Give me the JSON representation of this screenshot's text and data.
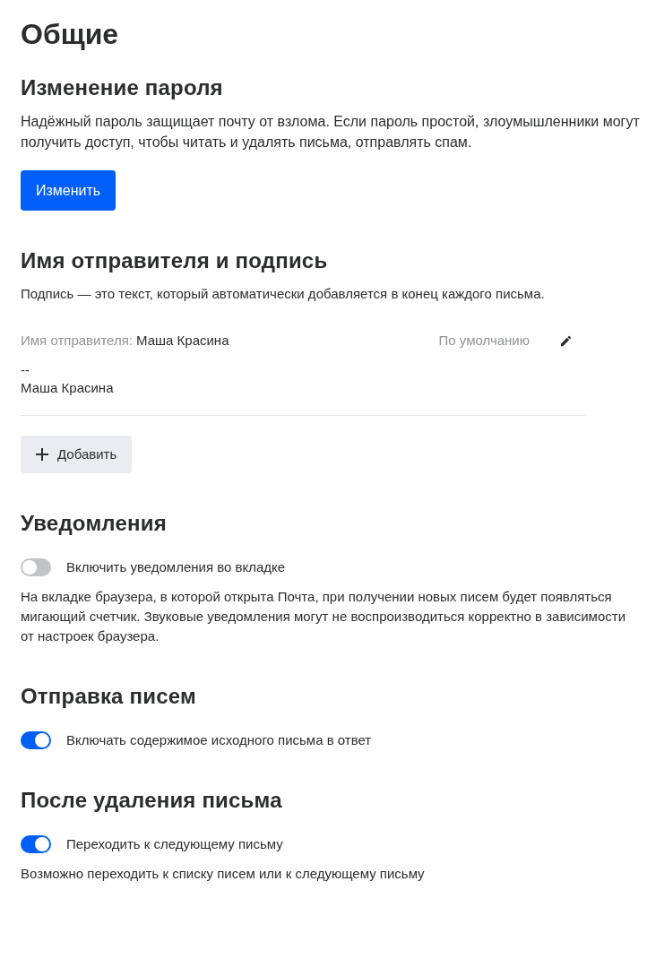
{
  "page_title": "Общие",
  "sections": [
    {
      "heading": "Изменение пароля",
      "items": [
        {
          "kind": "text",
          "text": "Надёжный пароль защищает почту от взлома. Если пароль простой, злоумышленники могут получить доступ, чтобы читать и удалять письма, отправлять спам."
        },
        {
          "kind": "button",
          "label": "Изменить"
        }
      ]
    },
    {
      "heading": "Имя отправителя и подпись",
      "items": [
        {
          "kind": "note",
          "text": "Подпись — это текст, который автоматически добавляется в конец каждого письма."
        },
        {
          "kind": "signature",
          "sender_label": "Имя отправителя:",
          "sender_name": "Маша Красина",
          "default_label": "По умолчанию",
          "lines": [
            "--",
            "Маша Красина"
          ]
        },
        {
          "kind": "add_button",
          "label": "Добавить"
        }
      ]
    },
    {
      "heading": "Уведомления",
      "items": [
        {
          "kind": "toggle",
          "label": "Включить уведомления во вкладке",
          "on": false
        },
        {
          "kind": "note",
          "text": "На вкладке браузера, в которой открыта Почта, при получении новых писем будет появляться мигающий счетчик. Звуковые уведомления могут не воспроизводиться корректно в зависимости от настроек браузера."
        }
      ]
    },
    {
      "heading": "Отправка писем",
      "items": [
        {
          "kind": "toggle",
          "label": "Включать содержимое исходного письма в ответ",
          "on": true
        }
      ]
    },
    {
      "heading": "После удаления письма",
      "items": [
        {
          "kind": "toggle",
          "label": "Переходить к следующему письму",
          "on": true
        },
        {
          "kind": "note",
          "text": "Возможно переходить к списку писем или к следующему письму"
        }
      ]
    }
  ]
}
